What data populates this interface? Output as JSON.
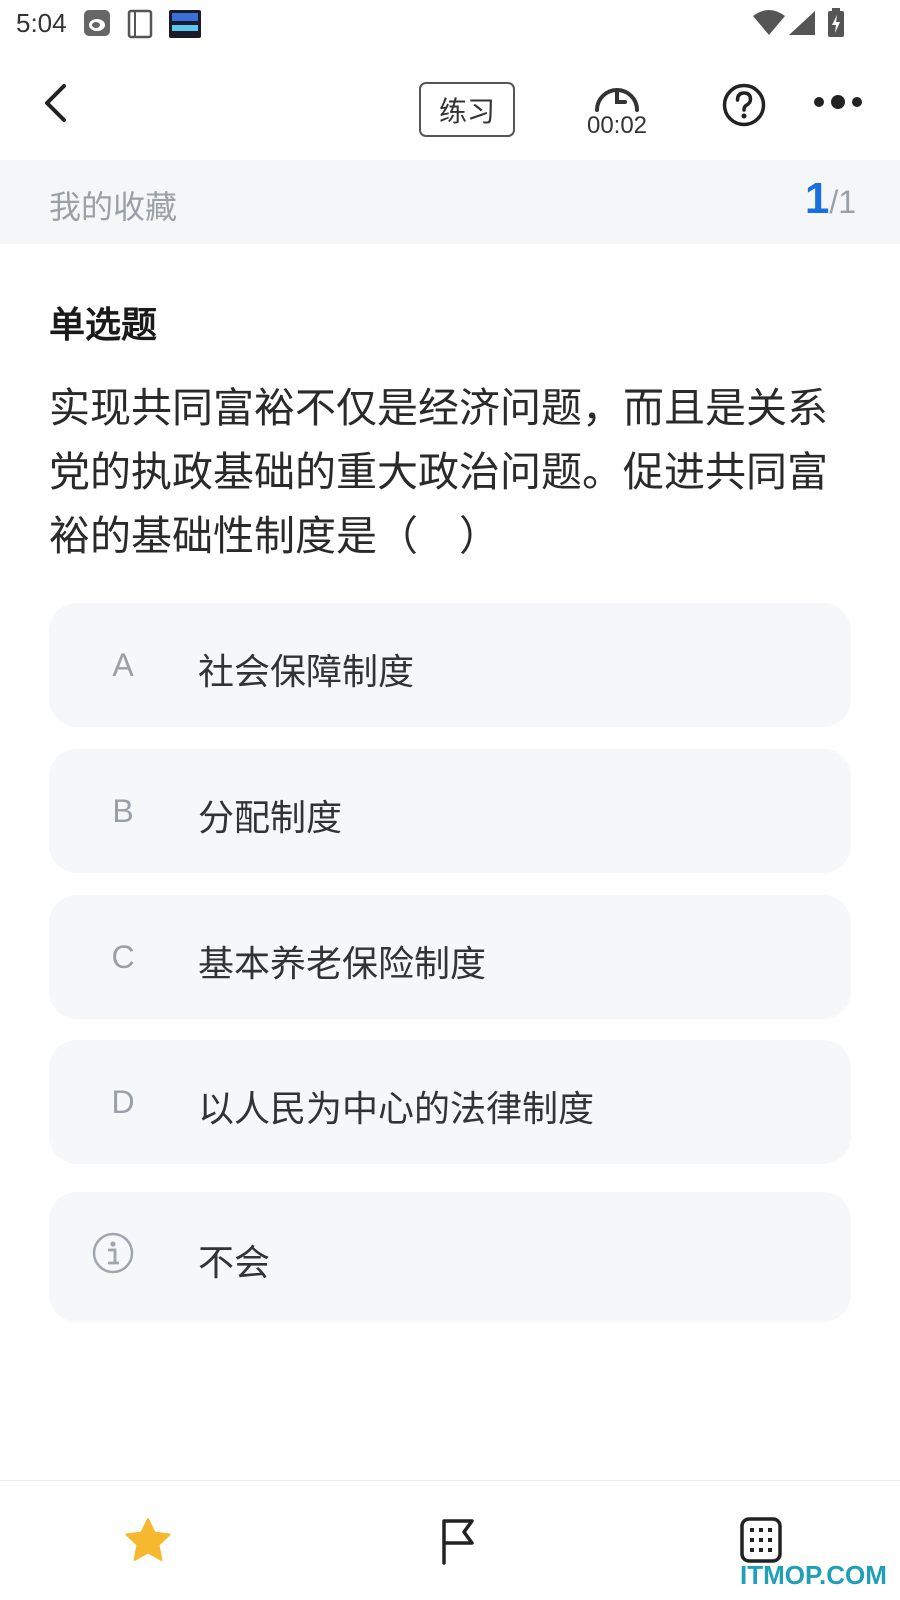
{
  "status_bar": {
    "time": "5:04",
    "icons": [
      "sina-weibo-icon",
      "book-icon",
      "clock-widget-icon",
      "wifi-icon",
      "cell-signal-icon",
      "battery-charging-icon"
    ]
  },
  "toolbar": {
    "back_icon": "chevron-left-icon",
    "mode_label": "练习",
    "timer": "00:02",
    "help_icon": "question-circle-icon",
    "more_icon": "more-dots-icon"
  },
  "breadcrumb": {
    "title": "我的收藏",
    "current": "1",
    "separator": "/",
    "total": "1"
  },
  "question": {
    "type": "单选题",
    "text": "实现共同富裕不仅是经济问题，而且是关系党的执政基础的重大政治问题。促进共同富裕的基础性制度是（　）"
  },
  "options": [
    {
      "letter": "A",
      "text": "社会保障制度"
    },
    {
      "letter": "B",
      "text": "分配制度"
    },
    {
      "letter": "C",
      "text": "基本养老保险制度"
    },
    {
      "letter": "D",
      "text": "以人民为中心的法律制度"
    }
  ],
  "dont_know": {
    "icon": "info-circle-icon",
    "text": "不会"
  },
  "bottom_bar": {
    "items": [
      "star-icon",
      "flag-icon",
      "answer-sheet-icon"
    ],
    "accent_star": "#f5b82e"
  },
  "watermark": "ITMOP.COM",
  "colors": {
    "accent": "#1a6fe0",
    "option_bg": "#f6f7f9",
    "crumb_bg": "#f5f6f8"
  }
}
